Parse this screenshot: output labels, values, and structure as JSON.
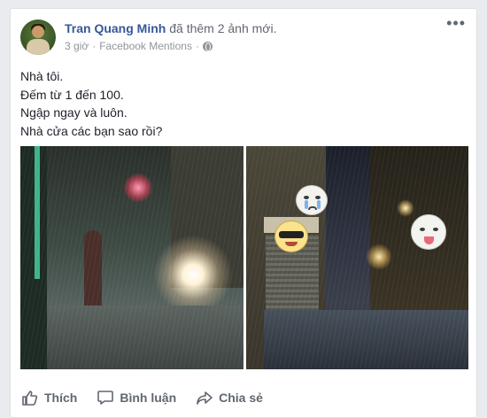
{
  "post": {
    "author": "Tran Quang Minh",
    "action_text": "đã thêm 2 ảnh mới.",
    "time": "3 giờ",
    "separator": "·",
    "source": "Facebook Mentions",
    "separator2": "·",
    "more": "•••",
    "text_lines": [
      "Nhà tôi.",
      "Đếm từ 1 đến 100.",
      "Ngập ngay và luôn.",
      "Nhà cửa các bạn sao rồi?"
    ]
  },
  "actions": {
    "like_label": "Thích",
    "comment_label": "Bình luận",
    "share_label": "Chia sẻ"
  },
  "icons": {
    "privacy": "globe-icon",
    "more": "more-options-icon",
    "like": "thumbs-up-icon",
    "comment": "comment-icon",
    "share": "share-arrow-icon"
  },
  "colors": {
    "author": "#365899",
    "meta": "#90949c",
    "action_text": "#606770"
  }
}
